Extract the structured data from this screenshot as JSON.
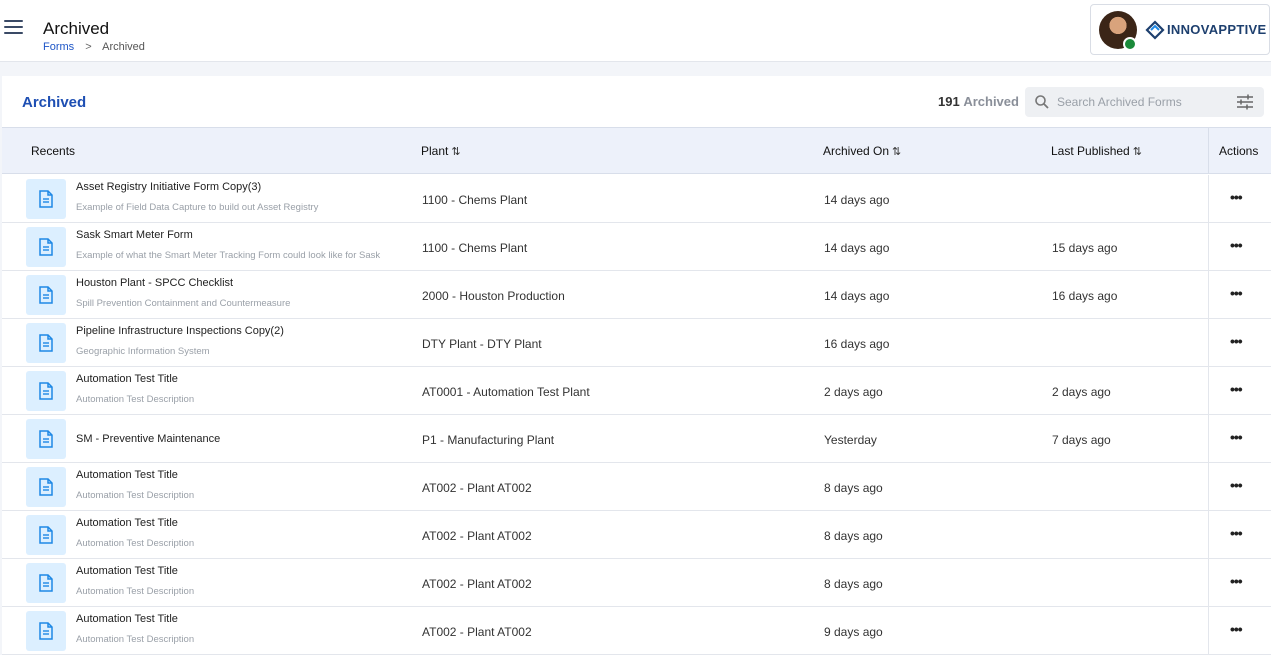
{
  "header": {
    "title": "Archived",
    "breadcrumb": {
      "root": "Forms",
      "separator": ">",
      "current": "Archived"
    },
    "brand": "INNOVAPPTIVE"
  },
  "panel": {
    "title": "Archived",
    "count_value": "191",
    "count_label": "Archived",
    "search_placeholder": "Search Archived Forms"
  },
  "table": {
    "columns": {
      "recents": "Recents",
      "plant": "Plant",
      "archived_on": "Archived On",
      "last_published": "Last Published",
      "actions": "Actions"
    },
    "sort_glyph": "⇅",
    "more_glyph": "•••",
    "rows": [
      {
        "name": "Asset Registry Initiative Form Copy(3)",
        "description": "Example of Field Data Capture to build out Asset Registry",
        "plant": "1100 - Chems Plant",
        "archived_on": "14 days ago",
        "last_published": ""
      },
      {
        "name": "Sask Smart Meter Form",
        "description": "Example of what the Smart Meter Tracking Form could look like for Sask",
        "plant": "1100 - Chems Plant",
        "archived_on": "14 days ago",
        "last_published": "15 days ago"
      },
      {
        "name": "Houston Plant - SPCC Checklist",
        "description": "Spill Prevention Containment and Countermeasure",
        "plant": "2000 - Houston Production",
        "archived_on": "14 days ago",
        "last_published": "16 days ago"
      },
      {
        "name": "Pipeline Infrastructure Inspections Copy(2)",
        "description": "Geographic Information System",
        "plant": "DTY Plant - DTY Plant",
        "archived_on": "16 days ago",
        "last_published": ""
      },
      {
        "name": "Automation Test Title",
        "description": "Automation Test Description",
        "plant": "AT0001 - Automation Test Plant",
        "archived_on": "2 days ago",
        "last_published": "2 days ago"
      },
      {
        "name": "SM - Preventive Maintenance",
        "description": "",
        "plant": "P1 - Manufacturing Plant",
        "archived_on": "Yesterday",
        "last_published": "7 days ago"
      },
      {
        "name": "Automation Test Title",
        "description": "Automation Test Description",
        "plant": "AT002 - Plant AT002",
        "archived_on": "8 days ago",
        "last_published": ""
      },
      {
        "name": "Automation Test Title",
        "description": "Automation Test Description",
        "plant": "AT002 - Plant AT002",
        "archived_on": "8 days ago",
        "last_published": ""
      },
      {
        "name": "Automation Test Title",
        "description": "Automation Test Description",
        "plant": "AT002 - Plant AT002",
        "archived_on": "8 days ago",
        "last_published": ""
      },
      {
        "name": "Automation Test Title",
        "description": "Automation Test Description",
        "plant": "AT002 - Plant AT002",
        "archived_on": "9 days ago",
        "last_published": ""
      }
    ]
  },
  "colors": {
    "accent": "#1e4fb3",
    "link": "#1e56c7",
    "header_bg": "#edf1fa",
    "icon_bg": "#dcefff",
    "icon_fg": "#1e88e5",
    "presence": "#1a8a3a"
  },
  "icons": {
    "menu": "hamburger-icon",
    "search": "search-icon",
    "filter": "filter-icon",
    "form": "document-icon",
    "more": "more-horizontal-icon"
  }
}
